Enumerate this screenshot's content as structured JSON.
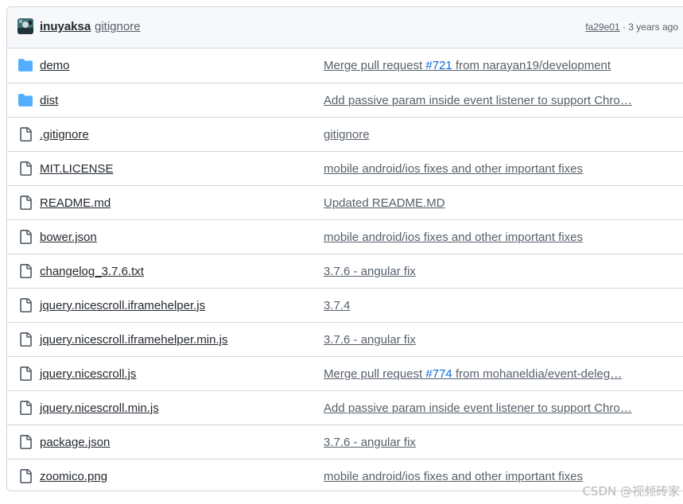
{
  "header": {
    "author": "inuyaksa",
    "commit_message": "gitignore",
    "sha": "fa29e01",
    "separator": " · ",
    "time": "3 years ago"
  },
  "files": [
    {
      "type": "folder",
      "name": "demo",
      "msg_prefix": "Merge pull request ",
      "pr": "#721",
      "msg_suffix": " from narayan19/development"
    },
    {
      "type": "folder",
      "name": "dist",
      "msg_prefix": "Add passive param inside event listener to support Chro…",
      "pr": "",
      "msg_suffix": ""
    },
    {
      "type": "file",
      "name": ".gitignore",
      "msg_prefix": "gitignore",
      "pr": "",
      "msg_suffix": ""
    },
    {
      "type": "file",
      "name": "MIT.LICENSE",
      "msg_prefix": "mobile android/ios fixes and other important fixes",
      "pr": "",
      "msg_suffix": ""
    },
    {
      "type": "file",
      "name": "README.md",
      "msg_prefix": "Updated README.MD",
      "pr": "",
      "msg_suffix": ""
    },
    {
      "type": "file",
      "name": "bower.json",
      "msg_prefix": "mobile android/ios fixes and other important fixes",
      "pr": "",
      "msg_suffix": ""
    },
    {
      "type": "file",
      "name": "changelog_3.7.6.txt",
      "msg_prefix": "3.7.6 - angular fix",
      "pr": "",
      "msg_suffix": ""
    },
    {
      "type": "file",
      "name": "jquery.nicescroll.iframehelper.js",
      "msg_prefix": "3.7.4",
      "pr": "",
      "msg_suffix": ""
    },
    {
      "type": "file",
      "name": "jquery.nicescroll.iframehelper.min.js",
      "msg_prefix": "3.7.6 - angular fix",
      "pr": "",
      "msg_suffix": ""
    },
    {
      "type": "file",
      "name": "jquery.nicescroll.js",
      "msg_prefix": "Merge pull request ",
      "pr": "#774",
      "msg_suffix": " from mohaneldia/event-deleg…"
    },
    {
      "type": "file",
      "name": "jquery.nicescroll.min.js",
      "msg_prefix": "Add passive param inside event listener to support Chro…",
      "pr": "",
      "msg_suffix": ""
    },
    {
      "type": "file",
      "name": "package.json",
      "msg_prefix": "3.7.6 - angular fix",
      "pr": "",
      "msg_suffix": ""
    },
    {
      "type": "file",
      "name": "zoomico.png",
      "msg_prefix": "mobile android/ios fixes and other important fixes",
      "pr": "",
      "msg_suffix": ""
    }
  ],
  "icons": {
    "folder": "folder-icon",
    "file": "file-icon"
  },
  "colors": {
    "folder": "#54aeff",
    "link": "#0969da",
    "muted": "#57606a",
    "border": "#d0d7de"
  },
  "watermark": "CSDN @视频砖家"
}
